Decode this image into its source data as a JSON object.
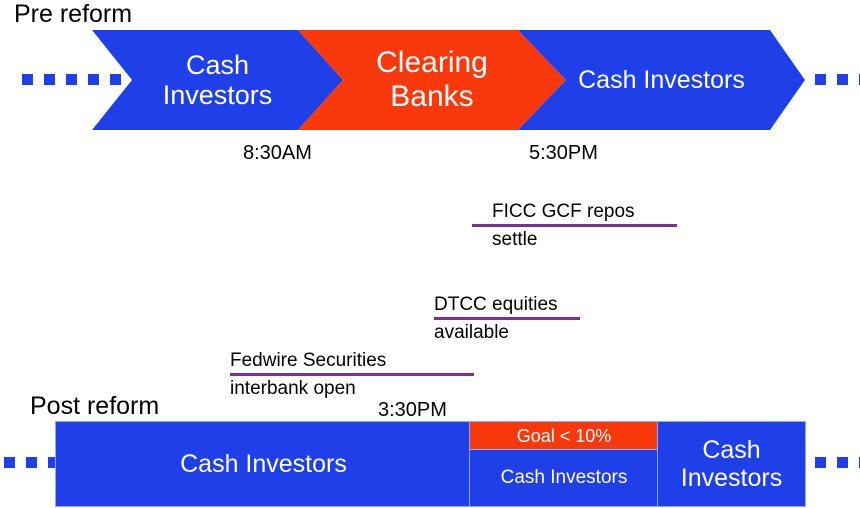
{
  "diagram": {
    "title_pre": "Pre reform",
    "title_post": "Post reform"
  },
  "pre_reform": {
    "flow": [
      {
        "label": "Cash\nInvestors",
        "color": "#1f3fe8",
        "role": "cash-investors-start"
      },
      {
        "label": "Clearing\nBanks",
        "color": "#f9380b",
        "role": "clearing-banks"
      },
      {
        "label": "Cash Investors",
        "color": "#1f3fe8",
        "role": "cash-investors-end"
      }
    ],
    "flow_labels": {
      "seg1_line1": "Cash",
      "seg1_line2": "Investors",
      "seg2_line1": "Clearing",
      "seg2_line2": "Banks",
      "seg3": "Cash Investors"
    },
    "times": {
      "open": "8:30AM",
      "close": "5:30PM"
    }
  },
  "annotations": [
    {
      "line1": "FICC GCF repos",
      "line2": "settle",
      "rule_color": "#7b2f8e"
    },
    {
      "line1": "DTCC equities",
      "line2": "available",
      "rule_color": "#7b2f8e"
    },
    {
      "line1": "Fedwire Securities",
      "line2": "interbank open",
      "rule_color": "#7b2f8e"
    }
  ],
  "annotation_items": {
    "ficc_line1": "FICC GCF repos",
    "ficc_line2": "settle",
    "dtcc_line1": "DTCC equities",
    "dtcc_line2": "available",
    "fedwire_line1": "Fedwire Securities",
    "fedwire_line2": "interbank open"
  },
  "post_reform": {
    "time": "3:30PM",
    "segments": {
      "left_label": "Cash Investors",
      "goal_label": "Goal < 10%",
      "middle_label": "Cash Investors",
      "right_line1": "Cash",
      "right_line2": "Investors"
    },
    "goal_value": "< 10%"
  },
  "colors": {
    "blue": "#1f3fe8",
    "red": "#f9380b",
    "purple_rule": "#7b2f8e",
    "text": "#000000",
    "bar_outline": "#93a8ef"
  },
  "leaders": {
    "top_left_dots": 6,
    "top_right_dots": 4,
    "bottom_left_dots": 4,
    "bottom_right_dots": 3
  }
}
